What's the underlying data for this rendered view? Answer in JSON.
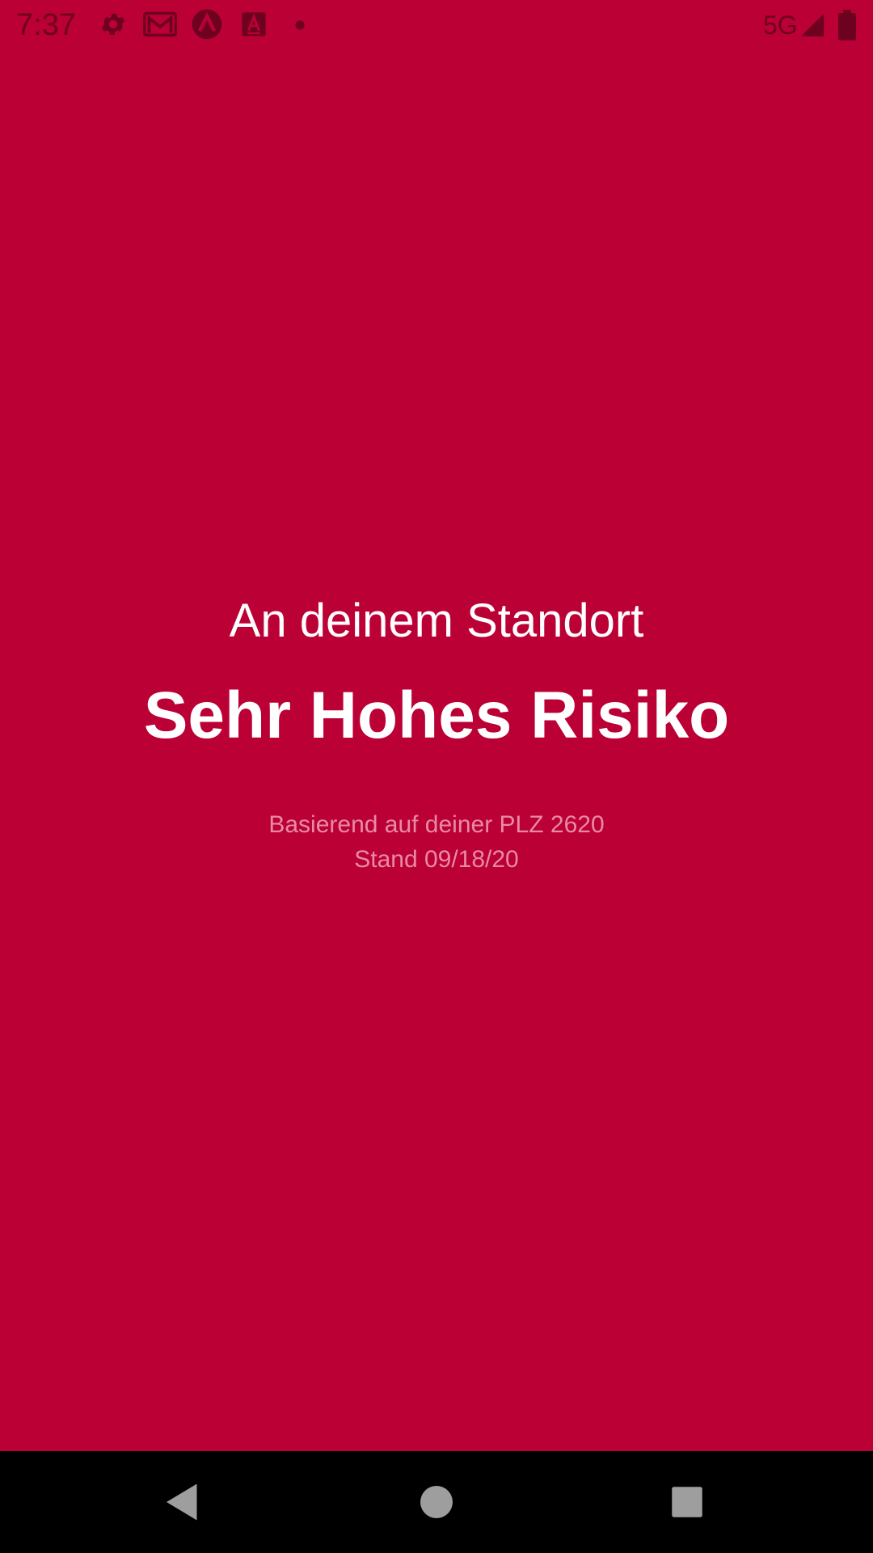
{
  "status_bar": {
    "time": "7:37",
    "network": "5G",
    "icons": [
      "settings-icon",
      "gmail-icon",
      "app-icon",
      "text-app-icon",
      "notification-dot-icon",
      "signal-icon",
      "battery-icon"
    ]
  },
  "main": {
    "subtitle": "An deinem Standort",
    "risk_level": "Sehr Hohes Risiko",
    "info_line_1": "Basierend auf deiner PLZ 2620",
    "info_line_2": "Stand 09/18/20"
  },
  "nav_bar": {
    "buttons": [
      "back-icon",
      "home-icon",
      "recents-icon"
    ]
  },
  "colors": {
    "background": "#bb0036",
    "status_icons": "#6e0020",
    "primary_text": "#ffffff",
    "secondary_text": "#e88aa5",
    "nav_bar": "#000000",
    "nav_icons": "#9e9e9e"
  }
}
